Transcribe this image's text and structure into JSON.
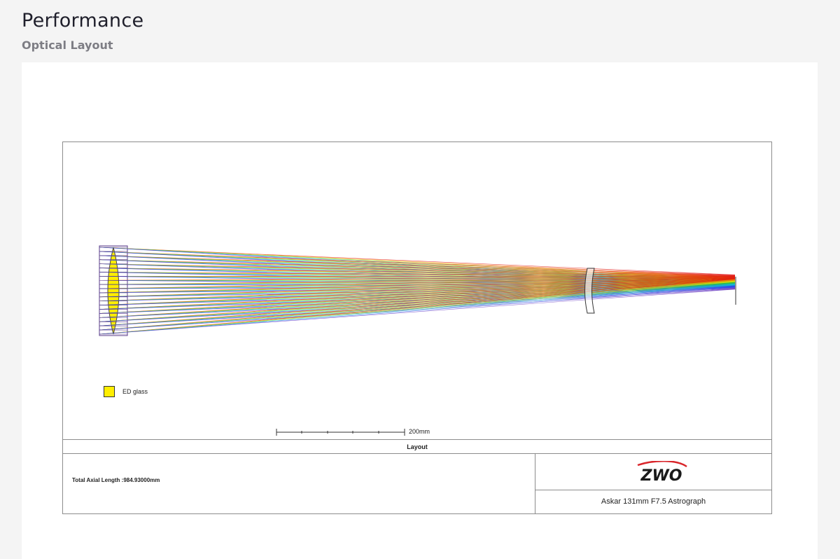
{
  "header": {
    "title": "Performance",
    "subtitle": "Optical Layout"
  },
  "diagram": {
    "legend": {
      "label": "ED glass",
      "color": "#ffee00"
    },
    "scale_bar": {
      "label": "200mm"
    },
    "layout_label": "Layout",
    "total_axial_length": "Total Axial Length :984.93000mm",
    "logo_text": "ZWO",
    "logo_colors": {
      "dark": "#1a1a1a",
      "accent": "#d9252a"
    },
    "product_name": "Askar 131mm F7.5 Astrograph",
    "spectrum_colors": [
      "#e01010",
      "#f07a00",
      "#f0e000",
      "#30c030",
      "#10c8c8",
      "#2050f0",
      "#6030c0"
    ]
  }
}
